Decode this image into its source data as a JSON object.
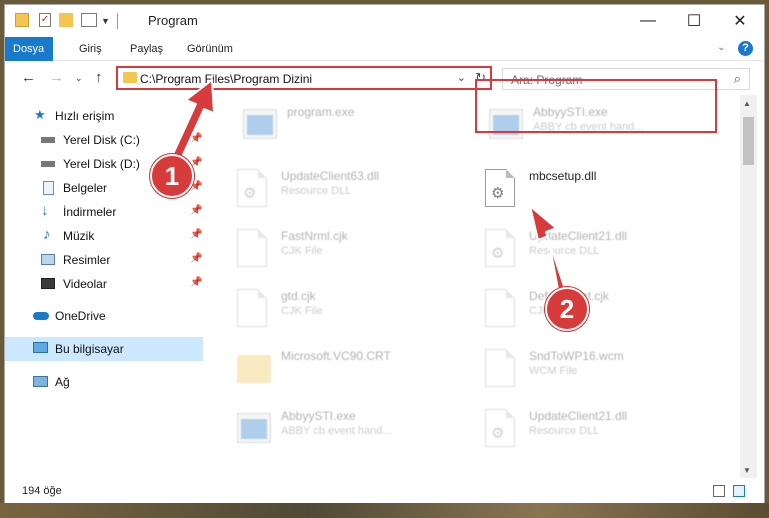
{
  "window": {
    "title": "Program"
  },
  "ribbon": {
    "tabs": [
      "Dosya",
      "Giriş",
      "Paylaş",
      "Görünüm"
    ]
  },
  "address": {
    "path": "C:\\Program Files\\Program Dizini"
  },
  "search": {
    "placeholder": "Ara: Program"
  },
  "sidebar": {
    "items": [
      {
        "label": "Hızlı erişim",
        "icon": "star-icon"
      },
      {
        "label": "Yerel Disk (C:)",
        "icon": "drive-icon",
        "pinned": true
      },
      {
        "label": "Yerel Disk (D:)",
        "icon": "drive-icon",
        "pinned": true
      },
      {
        "label": "Belgeler",
        "icon": "documents-icon",
        "pinned": true
      },
      {
        "label": "İndirmeler",
        "icon": "download-icon",
        "pinned": true
      },
      {
        "label": "Müzik",
        "icon": "music-icon",
        "pinned": true
      },
      {
        "label": "Resimler",
        "icon": "pictures-icon",
        "pinned": true
      },
      {
        "label": "Videolar",
        "icon": "videos-icon",
        "pinned": true
      },
      {
        "label": "OneDrive",
        "icon": "cloud-icon"
      },
      {
        "label": "Bu bilgisayar",
        "icon": "computer-icon",
        "selected": true
      },
      {
        "label": "Ağ",
        "icon": "network-icon"
      }
    ]
  },
  "files": [
    {
      "name": "program.exe",
      "type": "",
      "kind": "exe"
    },
    {
      "name": "AbbyySTI.exe",
      "type": "ABBY cb event hand...",
      "kind": "exe"
    },
    {
      "name": "UpdateClient63.dll",
      "type": "Resource DLL",
      "kind": "dll"
    },
    {
      "name": "mbcsetup.dll",
      "type": "",
      "kind": "dll",
      "highlighted": true
    },
    {
      "name": "FastNrml.cjk",
      "type": "CJK File",
      "kind": "doc"
    },
    {
      "name": "UpdateClient21.dll",
      "type": "Resource DLL",
      "kind": "dll"
    },
    {
      "name": "gtd.cjk",
      "type": "CJK File",
      "kind": "doc"
    },
    {
      "name": "DefaultFont.cjk",
      "type": "CJK File",
      "kind": "doc"
    },
    {
      "name": "Microsoft.VC90.CRT",
      "type": "",
      "kind": "folder"
    },
    {
      "name": "SndToWP16.wcm",
      "type": "WCM File",
      "kind": "doc"
    },
    {
      "name": "AbbyySTI.exe",
      "type": "ABBY cb event hand...",
      "kind": "exe"
    },
    {
      "name": "UpdateClient21.dll",
      "type": "Resource DLL",
      "kind": "dll"
    }
  ],
  "status": {
    "count": "194 öğe"
  },
  "annotations": {
    "badge1": "1",
    "badge2": "2"
  },
  "colors": {
    "accent": "#1979ca",
    "highlight": "#d63a3a"
  }
}
